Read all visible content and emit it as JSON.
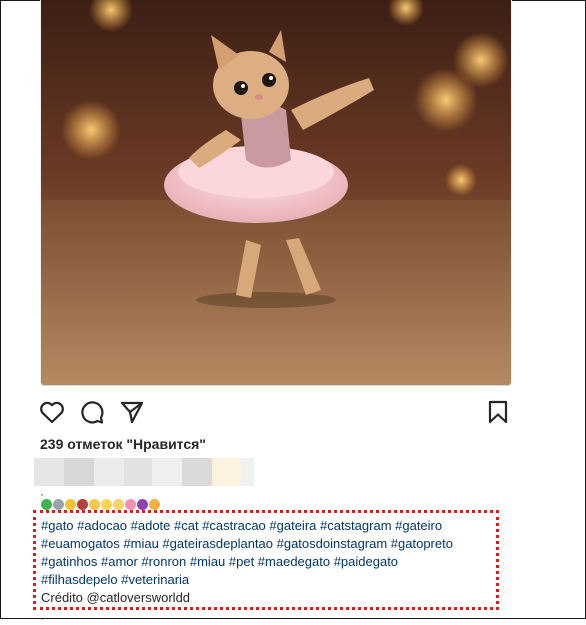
{
  "post": {
    "image_alt": "Kitten in a pink tutu dancing",
    "likes_text": "239 отметок \"Нравится\"",
    "separator_dot": "·",
    "emojis": [
      "#3fb34f",
      "#9aa4ad",
      "#f4c430",
      "#b0413e",
      "#f7c948",
      "#ffd54f",
      "#f9d26a",
      "#f48fb1",
      "#8e44ad",
      "#f5b041"
    ],
    "hashtag_lines": [
      "#gato #adocao #adote #cat #castracao #gateira #catstagram #gateiro",
      "#euamogatos #miau #gateirasdeplantao #gatosdoinstagram #gatopreto",
      "#gatinhos #amor #ronron #miau #pet #maedegato #paidegato",
      "#filhasdepelo #veterinaria"
    ],
    "credit": "Crédito @catloversworldd",
    "icons": [
      "heart-icon",
      "comment-icon",
      "share-icon",
      "bookmark-icon"
    ],
    "colors": {
      "highlight_border": "#d61f1f",
      "hashtag": "#00376b",
      "text": "#262626"
    }
  }
}
